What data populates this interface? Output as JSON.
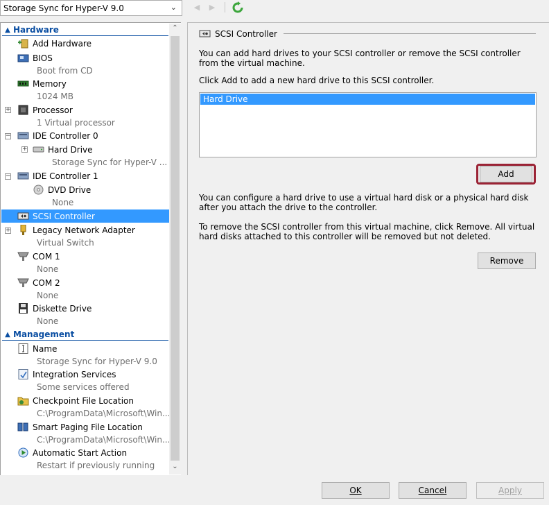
{
  "vm_selector": {
    "value": "Storage Sync for Hyper-V 9.0"
  },
  "hardware_section": {
    "title": "Hardware"
  },
  "hardware": {
    "add_hardware": "Add Hardware",
    "bios": {
      "label": "BIOS",
      "sub": "Boot from CD"
    },
    "memory": {
      "label": "Memory",
      "sub": "1024 MB"
    },
    "processor": {
      "label": "Processor",
      "sub": "1 Virtual processor"
    },
    "ide0": {
      "label": "IDE Controller 0"
    },
    "ide0_hdd": {
      "label": "Hard Drive",
      "sub": "Storage Sync for Hyper-V ..."
    },
    "ide1": {
      "label": "IDE Controller 1"
    },
    "ide1_dvd": {
      "label": "DVD Drive",
      "sub": "None"
    },
    "scsi": {
      "label": "SCSI Controller"
    },
    "network": {
      "label": "Legacy Network Adapter",
      "sub": "Virtual Switch"
    },
    "com1": {
      "label": "COM 1",
      "sub": "None"
    },
    "com2": {
      "label": "COM 2",
      "sub": "None"
    },
    "diskette": {
      "label": "Diskette Drive",
      "sub": "None"
    }
  },
  "management_section": {
    "title": "Management"
  },
  "management": {
    "name": {
      "label": "Name",
      "sub": "Storage Sync for Hyper-V 9.0"
    },
    "integration": {
      "label": "Integration Services",
      "sub": "Some services offered"
    },
    "checkpoint": {
      "label": "Checkpoint File Location",
      "sub": "C:\\ProgramData\\Microsoft\\Win..."
    },
    "paging": {
      "label": "Smart Paging File Location",
      "sub": "C:\\ProgramData\\Microsoft\\Win..."
    },
    "autostart": {
      "label": "Automatic Start Action",
      "sub": "Restart if previously running"
    }
  },
  "detail": {
    "title": "SCSI Controller",
    "intro": "You can add hard drives to your SCSI controller or remove the SCSI controller from the virtual machine.",
    "click_add": "Click Add to add a new hard drive to this SCSI controller.",
    "drive_list_item": "Hard Drive",
    "add_button": "Add",
    "configure_text": "You can configure a hard drive to use a virtual hard disk or a physical hard disk after you attach the drive to the controller.",
    "remove_text": "To remove the SCSI controller from this virtual machine, click Remove. All virtual hard disks attached to this controller will be removed but not deleted.",
    "remove_button": "Remove"
  },
  "footer": {
    "ok": "OK",
    "cancel": "Cancel",
    "apply": "Apply"
  },
  "colors": {
    "selection": "#3399ff",
    "section_header": "#0a4ea2",
    "highlight_border": "#9b2335"
  }
}
